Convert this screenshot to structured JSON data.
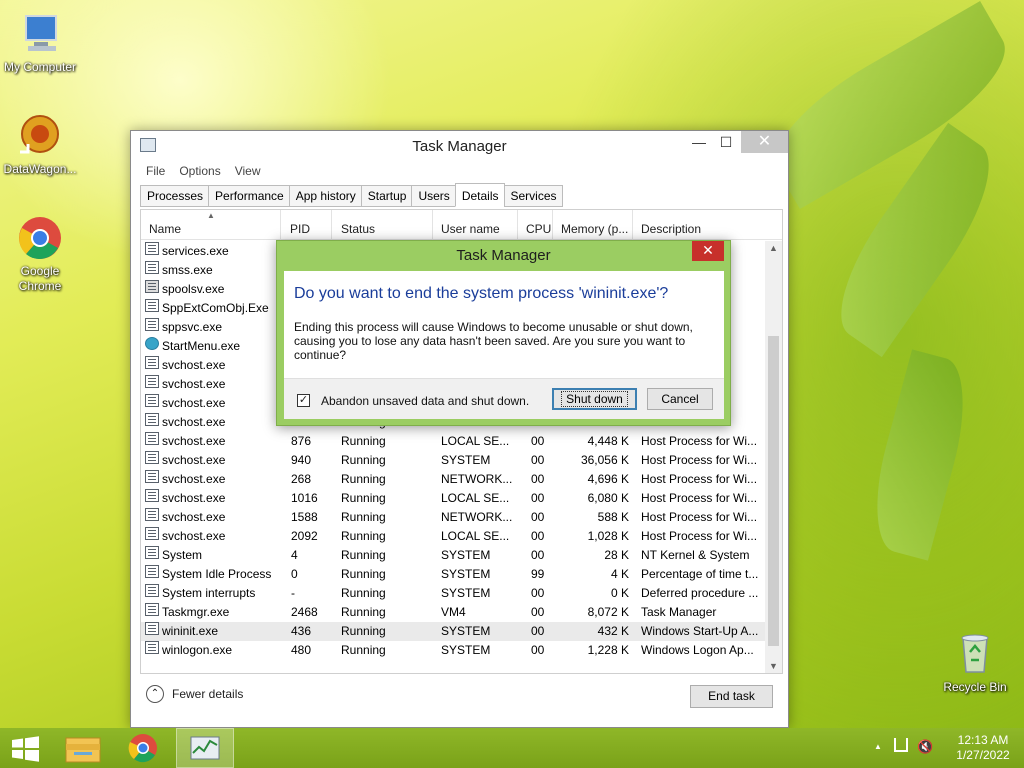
{
  "desktop": {
    "icons": [
      {
        "label": "My Computer"
      },
      {
        "label": "DataWagon..."
      },
      {
        "label": "Google Chrome"
      },
      {
        "label": "Recycle Bin"
      }
    ]
  },
  "window": {
    "title": "Task Manager",
    "menu": [
      "File",
      "Options",
      "View"
    ],
    "tabs": [
      "Processes",
      "Performance",
      "App history",
      "Startup",
      "Users",
      "Details",
      "Services"
    ],
    "active_tab": "Details",
    "columns": [
      "Name",
      "PID",
      "Status",
      "User name",
      "CPU",
      "Memory (p...",
      "Description"
    ],
    "rows": [
      {
        "name": "services.exe",
        "pid": "",
        "status": "",
        "user": "",
        "cpu": "",
        "mem": "",
        "desc": "...trol...",
        "icon": "pic"
      },
      {
        "name": "smss.exe",
        "pid": "",
        "status": "",
        "user": "",
        "cpu": "",
        "mem": "",
        "desc": "...M...",
        "icon": "pic"
      },
      {
        "name": "spoolsv.exe",
        "pid": "",
        "status": "",
        "user": "",
        "cpu": "",
        "mem": "",
        "desc": "...m ...",
        "icon": "printer"
      },
      {
        "name": "SppExtComObj.Exe",
        "pid": "",
        "status": "",
        "user": "",
        "cpu": "",
        "mem": "",
        "desc": "...Br...",
        "icon": "pic"
      },
      {
        "name": "sppsvc.exe",
        "pid": "",
        "status": "",
        "user": "",
        "cpu": "",
        "mem": "",
        "desc": "...e ...",
        "icon": "pic"
      },
      {
        "name": "StartMenu.exe",
        "pid": "",
        "status": "",
        "user": "",
        "cpu": "",
        "mem": "",
        "desc": "",
        "icon": "round"
      },
      {
        "name": "svchost.exe",
        "pid": "",
        "status": "",
        "user": "",
        "cpu": "",
        "mem": "",
        "desc": "...Wi...",
        "icon": "pic"
      },
      {
        "name": "svchost.exe",
        "pid": "",
        "status": "",
        "user": "",
        "cpu": "",
        "mem": "",
        "desc": "...Wi...",
        "icon": "pic"
      },
      {
        "name": "svchost.exe",
        "pid": "",
        "status": "",
        "user": "",
        "cpu": "",
        "mem": "",
        "desc": "...Wi...",
        "icon": "pic"
      },
      {
        "name": "svchost.exe",
        "pid": "",
        "status": "Running",
        "user": "LOCAL SE...",
        "cpu": "00",
        "mem": "",
        "desc": "...Wi...",
        "icon": "pic"
      },
      {
        "name": "svchost.exe",
        "pid": "876",
        "status": "Running",
        "user": "LOCAL SE...",
        "cpu": "00",
        "mem": "4,448 K",
        "desc": "Host Process for Wi...",
        "icon": "pic"
      },
      {
        "name": "svchost.exe",
        "pid": "940",
        "status": "Running",
        "user": "SYSTEM",
        "cpu": "00",
        "mem": "36,056 K",
        "desc": "Host Process for Wi...",
        "icon": "pic"
      },
      {
        "name": "svchost.exe",
        "pid": "268",
        "status": "Running",
        "user": "NETWORK...",
        "cpu": "00",
        "mem": "4,696 K",
        "desc": "Host Process for Wi...",
        "icon": "pic"
      },
      {
        "name": "svchost.exe",
        "pid": "1016",
        "status": "Running",
        "user": "LOCAL SE...",
        "cpu": "00",
        "mem": "6,080 K",
        "desc": "Host Process for Wi...",
        "icon": "pic"
      },
      {
        "name": "svchost.exe",
        "pid": "1588",
        "status": "Running",
        "user": "NETWORK...",
        "cpu": "00",
        "mem": "588 K",
        "desc": "Host Process for Wi...",
        "icon": "pic"
      },
      {
        "name": "svchost.exe",
        "pid": "2092",
        "status": "Running",
        "user": "LOCAL SE...",
        "cpu": "00",
        "mem": "1,028 K",
        "desc": "Host Process for Wi...",
        "icon": "pic"
      },
      {
        "name": "System",
        "pid": "4",
        "status": "Running",
        "user": "SYSTEM",
        "cpu": "00",
        "mem": "28 K",
        "desc": "NT Kernel & System",
        "icon": "pic"
      },
      {
        "name": "System Idle Process",
        "pid": "0",
        "status": "Running",
        "user": "SYSTEM",
        "cpu": "99",
        "mem": "4 K",
        "desc": "Percentage of time t...",
        "icon": "pic"
      },
      {
        "name": "System interrupts",
        "pid": "-",
        "status": "Running",
        "user": "SYSTEM",
        "cpu": "00",
        "mem": "0 K",
        "desc": "Deferred procedure ...",
        "icon": "pic"
      },
      {
        "name": "Taskmgr.exe",
        "pid": "2468",
        "status": "Running",
        "user": "VM4",
        "cpu": "00",
        "mem": "8,072 K",
        "desc": "Task Manager",
        "icon": "pic"
      },
      {
        "name": "wininit.exe",
        "pid": "436",
        "status": "Running",
        "user": "SYSTEM",
        "cpu": "00",
        "mem": "432 K",
        "desc": "Windows Start-Up A...",
        "icon": "pic",
        "selected": true
      },
      {
        "name": "winlogon.exe",
        "pid": "480",
        "status": "Running",
        "user": "SYSTEM",
        "cpu": "00",
        "mem": "1,228 K",
        "desc": "Windows Logon Ap...",
        "icon": "pic"
      }
    ],
    "fewer_details": "Fewer details",
    "end_task": "End task"
  },
  "dialog": {
    "title": "Task Manager",
    "question": "Do you want to end the system process 'wininit.exe'?",
    "message": "Ending this process will cause Windows to become unusable or shut down, causing you to lose any data hasn't been saved. Are you sure you want to continue?",
    "checkbox_label": "Abandon unsaved data and shut down.",
    "checkbox_checked": true,
    "shutdown_label": "Shut down",
    "cancel_label": "Cancel"
  },
  "taskbar": {
    "time": "12:13 AM",
    "date": "1/27/2022"
  },
  "colors": {
    "dialog_frame": "#9bcd62",
    "question_text": "#1a3d9a",
    "taskbar": "#86ad22",
    "close_red": "#c7302b"
  }
}
